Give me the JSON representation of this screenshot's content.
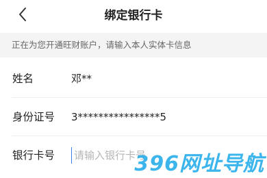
{
  "header": {
    "title": "绑定银行卡",
    "back_icon": "chevron-left-icon"
  },
  "notice": {
    "text": "正在为您开通旺财账户，请输入本人实体卡信息"
  },
  "form": {
    "name": {
      "label": "姓名",
      "value": "邓**"
    },
    "id_number": {
      "label": "身份证号",
      "value": "3****************5"
    },
    "card_number": {
      "label": "银行卡号",
      "placeholder": "请输入银行卡号",
      "value": ""
    }
  },
  "watermark": {
    "text": "396网址导航"
  },
  "colors": {
    "notice_bg": "#f4f4f5",
    "cursor": "#3b7ded",
    "watermark": "#1aa9e8"
  }
}
